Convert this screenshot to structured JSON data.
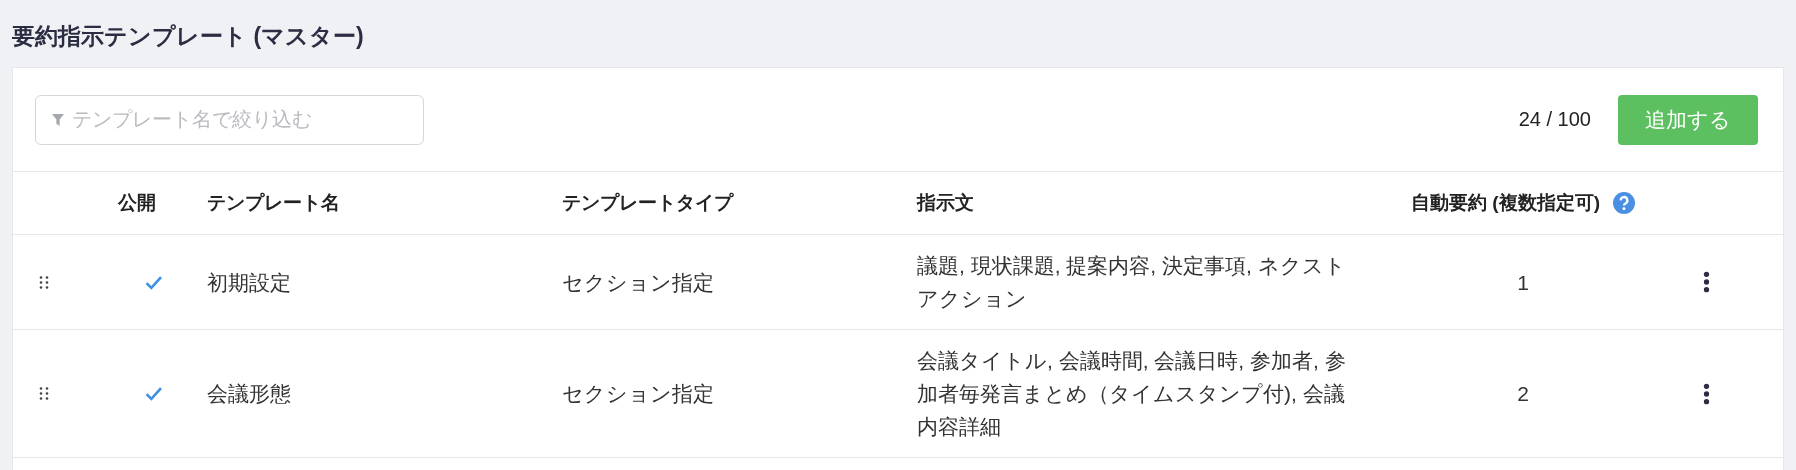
{
  "title": "要約指示テンプレート (マスター)",
  "filter": {
    "placeholder": "テンプレート名で絞り込む"
  },
  "count": "24 / 100",
  "add_button": "追加する",
  "columns": [
    "公開",
    "テンプレート名",
    "テンプレートタイプ",
    "指示文",
    "自動要約 (複数指定可)"
  ],
  "rows": [
    {
      "published": true,
      "name": "初期設定",
      "type": "セクション指定",
      "instruction": "議題, 現状課題, 提案内容, 決定事項, ネクストアクション",
      "auto": "1"
    },
    {
      "published": true,
      "name": "会議形態",
      "type": "セクション指定",
      "instruction": "会議タイトル, 会議時間, 会議日時, 参加者, 参加者毎発言まとめ（タイムスタンプ付), 会議内容詳細",
      "auto": "2"
    }
  ]
}
